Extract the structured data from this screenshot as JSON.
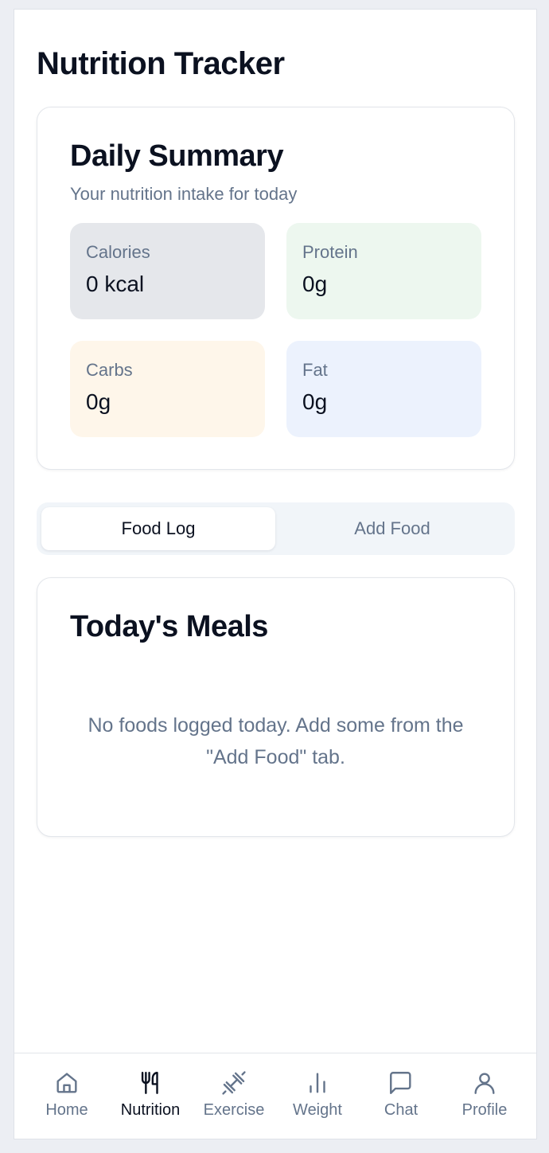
{
  "header": {
    "title": "Nutrition Tracker"
  },
  "summary": {
    "title": "Daily Summary",
    "subtitle": "Your nutrition intake for today",
    "stats": {
      "calories": {
        "label": "Calories",
        "value": "0 kcal"
      },
      "protein": {
        "label": "Protein",
        "value": "0g"
      },
      "carbs": {
        "label": "Carbs",
        "value": "0g"
      },
      "fat": {
        "label": "Fat",
        "value": "0g"
      }
    }
  },
  "tabs": [
    {
      "label": "Food Log",
      "active": true
    },
    {
      "label": "Add Food",
      "active": false
    }
  ],
  "meals": {
    "title": "Today's Meals",
    "empty_message": "No foods logged today. Add some from the \"Add Food\" tab."
  },
  "nav": [
    {
      "label": "Home",
      "icon": "home-icon",
      "active": false
    },
    {
      "label": "Nutrition",
      "icon": "utensils-icon",
      "active": true
    },
    {
      "label": "Exercise",
      "icon": "dumbbell-icon",
      "active": false
    },
    {
      "label": "Weight",
      "icon": "bar-chart-icon",
      "active": false
    },
    {
      "label": "Chat",
      "icon": "message-icon",
      "active": false
    },
    {
      "label": "Profile",
      "icon": "user-icon",
      "active": false
    }
  ],
  "colors": {
    "text": "#0b1120",
    "muted": "#64748b",
    "calories_bg": "#e5e7eb",
    "protein_bg": "#edf7ef",
    "carbs_bg": "#fef6ea",
    "fat_bg": "#ecf2fd"
  }
}
